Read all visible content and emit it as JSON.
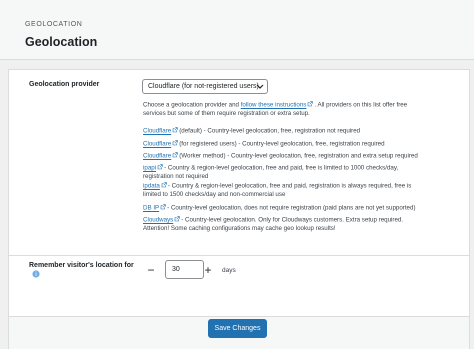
{
  "header": {
    "breadcrumb": "GEOLOCATION",
    "title": "Geolocation"
  },
  "provider": {
    "label": "Geolocation provider",
    "selected": "Cloudflare (for not-registered users)",
    "intro_before": "Choose a geolocation provider and ",
    "intro_link": "follow these instructions",
    "intro_after": ". All providers on this list offer free",
    "intro_line2": "services but some of them require registration or extra setup.",
    "items": [
      {
        "name": "Cloudflare",
        "lines": [
          "(default) - Country-level geolocation, free, registration not required"
        ]
      },
      {
        "name": "Cloudflare",
        "lines": [
          "(for registered users) - Country-level geolocation, free, registration required"
        ]
      },
      {
        "name": "Cloudflare",
        "lines": [
          "(Worker method) - Country-level geolocation, free, registration and extra setup required"
        ]
      },
      {
        "name": "ipapi",
        "lines": [
          "- Country & region-level geolocation, free and paid, free is limited to 1000 checks/day,",
          "registration not required"
        ]
      },
      {
        "name": "ipdata",
        "lines": [
          "- Country & region-level geolocation, free and paid, registration is always required, free is",
          "limited to 1500 checks/day and non-commercial use"
        ]
      },
      {
        "name": "DB IP",
        "lines": [
          "- Country-level geolocation, does not require registration (paid plans are not yet supported)"
        ]
      },
      {
        "name": "Cloudways",
        "lines": [
          "- Country-level geolocation. Only for Cloudways customers. Extra setup required.",
          "Attention! Some caching configurations may cache geo lookup results!"
        ]
      }
    ]
  },
  "remember": {
    "label": "Remember visitor's location for",
    "value": "30",
    "unit": "days",
    "minus": "−",
    "plus": "+"
  },
  "footer": {
    "save_label": "Save Changes"
  },
  "colors": {
    "link": "#2271b1",
    "primary_button": "#2271b1",
    "page_bg": "#f0f0f1"
  },
  "icons": [
    "external-link-icon",
    "chevron-down-icon",
    "help-icon",
    "minus-icon",
    "plus-icon"
  ]
}
